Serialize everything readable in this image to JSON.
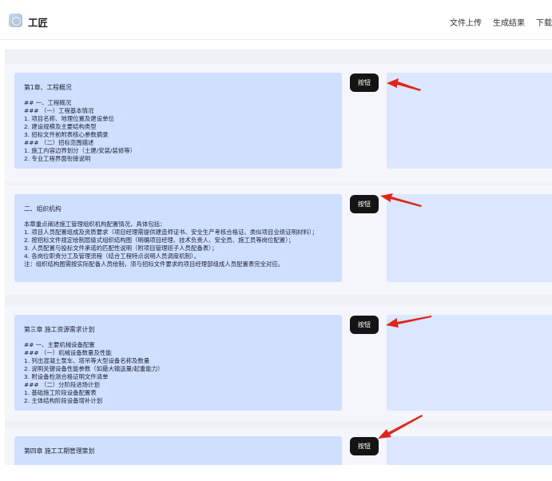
{
  "header": {
    "brand": "工匠",
    "nav": [
      "文件上传",
      "生成结果",
      "下载结果"
    ]
  },
  "sections": [
    {
      "title": "第1章、工程概况",
      "lines": [
        "## 一、工程概况",
        "### （一）工程基本情况",
        "1. 项目名称、地理位置及建设单位",
        "2. 建设规模及主要结构类型",
        "3. 招标文件前附表核心参数摘录",
        "### （二）招标范围描述",
        "1. 施工内容边界划分（土建/安装/装修等）",
        "2. 专业工程界面衔接说明"
      ],
      "button": "按钮"
    },
    {
      "title": "二、组织机构",
      "lines": [
        "本章重点阐述施工管理组织机构配置情况，具体包括：",
        "1. 项目人员配置组成及资质要求（项目经理需提供建造师证书、安全生产考核合格证、类似项目业绩证明材料）；",
        "2. 按招标文件规定绘制层级式组织结构图（明确项目经理、技术负责人、安全员、施工员等岗位配置）；",
        "3. 人员配置与投标文件承诺的匹配性说明（附项目管理班子人员配备表）；",
        "4. 各岗位职责分工及管理流程（结合工程特点说明人员调度机制）。",
        "注：组织结构图需按实际配备人员绘制，须与招标文件要求的项目经理部组成人员配置表完全对应。"
      ],
      "button": "按钮"
    },
    {
      "title": "第三章 施工资源需求计划",
      "lines": [
        "## 一、主要机械设备配置",
        "### （一）机械设备数量及性能",
        "1. 列出混凝土泵车、塔吊等大型设备名称及数量",
        "2. 说明关键设备性能参数（如最大输送量/起重能力）",
        "3. 附设备检测合格证明文件清单",
        "### （二）分阶段进场计划",
        "1. 基础施工阶段设备配置表",
        "2. 主体结构阶段设备增补计划"
      ],
      "button": "按钮"
    },
    {
      "title": "第四章 施工工期管理策划",
      "lines": [],
      "button": "按钮"
    }
  ],
  "annotation_color": "#e0241b"
}
